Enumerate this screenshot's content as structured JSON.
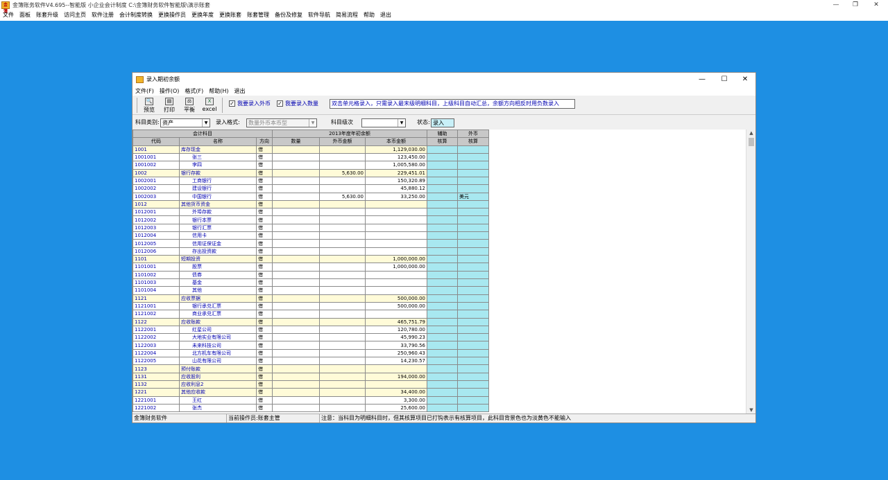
{
  "app": {
    "title": "金簿账务软件V4.695--智能版 小企业会计制度   C:\\金簿财务软件智能版\\演示账套",
    "icon_label": "金簿",
    "menu": [
      "文件",
      "面板",
      "账套升级",
      "访问主页",
      "软件注册",
      "会计制度转换",
      "更换操作员",
      "更换年度",
      "更换账套",
      "账套管理",
      "备份及修复",
      "软件导航",
      "简易流程",
      "帮助",
      "退出"
    ],
    "window_controls": {
      "minimize": "—",
      "restore": "❐",
      "close": "✕"
    }
  },
  "dialog": {
    "title": "录入期初余额",
    "menu": [
      "文件(F)",
      "操作(O)",
      "格式(F)",
      "帮助(H)",
      "退出"
    ],
    "window_controls": {
      "minimize": "—",
      "maximize": "☐",
      "close": "✕"
    },
    "toolbar": {
      "preview": "预览",
      "print": "打印",
      "balance": "平衡",
      "excel": "excel",
      "foreign_checkbox": "我要录入外币",
      "foreign_checked": "✓",
      "quantity_checkbox": "我要录入数量",
      "quantity_checked": "✓",
      "hint": "双击单元格录入，只需录入最末级明细科目，上级科目自动汇总，余额方向相反时用负数录入"
    },
    "filters": {
      "category_label": "科目类别:",
      "category_value": "资产",
      "format_label": "录入格式:",
      "format_value": "数量外币本币型",
      "level_label": "科目级次",
      "level_value": "",
      "status_label": "状态:",
      "status_value": "录入"
    },
    "grid": {
      "group_headers": {
        "account": "会计科目",
        "year": "2013年度年初余额",
        "aux": "辅助",
        "fx": "外币"
      },
      "headers": {
        "code": "代码",
        "name": "名称",
        "dir": "方向",
        "qty": "数量",
        "fx_amount": "外币金额",
        "amount": "本币金额",
        "aux_check": "核算",
        "fx_check": "核算"
      },
      "rows": [
        {
          "code": "1001",
          "name": "库存现金",
          "dir": "借",
          "qty": "",
          "fx": "",
          "amt": "1,129,030.00",
          "aux": "",
          "cur": "",
          "level": 1
        },
        {
          "code": "1001001",
          "name": "张三",
          "dir": "借",
          "qty": "",
          "fx": "",
          "amt": "123,450.00",
          "aux": "",
          "cur": "",
          "level": 2
        },
        {
          "code": "1001002",
          "name": "李四",
          "dir": "借",
          "qty": "",
          "fx": "",
          "amt": "1,005,580.00",
          "aux": "",
          "cur": "",
          "level": 2
        },
        {
          "code": "1002",
          "name": "银行存款",
          "dir": "借",
          "qty": "",
          "fx": "5,630.00",
          "amt": "229,451.01",
          "aux": "",
          "cur": "",
          "level": 1
        },
        {
          "code": "1002001",
          "name": "工商银行",
          "dir": "借",
          "qty": "",
          "fx": "",
          "amt": "150,320.89",
          "aux": "",
          "cur": "",
          "level": 2
        },
        {
          "code": "1002002",
          "name": "建设银行",
          "dir": "借",
          "qty": "",
          "fx": "",
          "amt": "45,880.12",
          "aux": "",
          "cur": "",
          "level": 2
        },
        {
          "code": "1002003",
          "name": "中国银行",
          "dir": "借",
          "qty": "",
          "fx": "5,630.00",
          "amt": "33,250.00",
          "aux": "",
          "cur": "美元",
          "level": 2
        },
        {
          "code": "1012",
          "name": "其他货币资金",
          "dir": "借",
          "qty": "",
          "fx": "",
          "amt": "",
          "aux": "",
          "cur": "",
          "level": 1
        },
        {
          "code": "1012001",
          "name": "外埠存款",
          "dir": "借",
          "qty": "",
          "fx": "",
          "amt": "",
          "aux": "",
          "cur": "",
          "level": 2
        },
        {
          "code": "1012002",
          "name": "银行本票",
          "dir": "借",
          "qty": "",
          "fx": "",
          "amt": "",
          "aux": "",
          "cur": "",
          "level": 2
        },
        {
          "code": "1012003",
          "name": "银行汇票",
          "dir": "借",
          "qty": "",
          "fx": "",
          "amt": "",
          "aux": "",
          "cur": "",
          "level": 2
        },
        {
          "code": "1012004",
          "name": "信用卡",
          "dir": "借",
          "qty": "",
          "fx": "",
          "amt": "",
          "aux": "",
          "cur": "",
          "level": 2
        },
        {
          "code": "1012005",
          "name": "信用证保证金",
          "dir": "借",
          "qty": "",
          "fx": "",
          "amt": "",
          "aux": "",
          "cur": "",
          "level": 2
        },
        {
          "code": "1012006",
          "name": "存出投资款",
          "dir": "借",
          "qty": "",
          "fx": "",
          "amt": "",
          "aux": "",
          "cur": "",
          "level": 2
        },
        {
          "code": "1101",
          "name": "短期投资",
          "dir": "借",
          "qty": "",
          "fx": "",
          "amt": "1,000,000.00",
          "aux": "",
          "cur": "",
          "level": 1
        },
        {
          "code": "1101001",
          "name": "股票",
          "dir": "借",
          "qty": "",
          "fx": "",
          "amt": "1,000,000.00",
          "aux": "",
          "cur": "",
          "level": 2
        },
        {
          "code": "1101002",
          "name": "债券",
          "dir": "借",
          "qty": "",
          "fx": "",
          "amt": "",
          "aux": "",
          "cur": "",
          "level": 2
        },
        {
          "code": "1101003",
          "name": "基金",
          "dir": "借",
          "qty": "",
          "fx": "",
          "amt": "",
          "aux": "",
          "cur": "",
          "level": 2
        },
        {
          "code": "1101004",
          "name": "其他",
          "dir": "借",
          "qty": "",
          "fx": "",
          "amt": "",
          "aux": "",
          "cur": "",
          "level": 2
        },
        {
          "code": "1121",
          "name": "应收票据",
          "dir": "借",
          "qty": "",
          "fx": "",
          "amt": "500,000.00",
          "aux": "",
          "cur": "",
          "level": 1
        },
        {
          "code": "1121001",
          "name": "银行承兑汇票",
          "dir": "借",
          "qty": "",
          "fx": "",
          "amt": "500,000.00",
          "aux": "",
          "cur": "",
          "level": 2
        },
        {
          "code": "1121002",
          "name": "商业承兑汇票",
          "dir": "借",
          "qty": "",
          "fx": "",
          "amt": "",
          "aux": "",
          "cur": "",
          "level": 2
        },
        {
          "code": "1122",
          "name": "应收账款",
          "dir": "借",
          "qty": "",
          "fx": "",
          "amt": "465,751.79",
          "aux": "",
          "cur": "",
          "level": 1
        },
        {
          "code": "1122001",
          "name": "红星公司",
          "dir": "借",
          "qty": "",
          "fx": "",
          "amt": "120,780.00",
          "aux": "",
          "cur": "",
          "level": 2
        },
        {
          "code": "1122002",
          "name": "大地实业有限公司",
          "dir": "借",
          "qty": "",
          "fx": "",
          "amt": "45,990.23",
          "aux": "",
          "cur": "",
          "level": 2
        },
        {
          "code": "1122003",
          "name": "未来科技公司",
          "dir": "借",
          "qty": "",
          "fx": "",
          "amt": "33,790.56",
          "aux": "",
          "cur": "",
          "level": 2
        },
        {
          "code": "1122004",
          "name": "北方机车有限公司",
          "dir": "借",
          "qty": "",
          "fx": "",
          "amt": "250,960.43",
          "aux": "",
          "cur": "",
          "level": 2
        },
        {
          "code": "1122005",
          "name": "山花有限公司",
          "dir": "借",
          "qty": "",
          "fx": "",
          "amt": "14,230.57",
          "aux": "",
          "cur": "",
          "level": 2
        },
        {
          "code": "1123",
          "name": "预付账款",
          "dir": "借",
          "qty": "",
          "fx": "",
          "amt": "",
          "aux": "",
          "cur": "",
          "level": 1
        },
        {
          "code": "1131",
          "name": "应收股利",
          "dir": "借",
          "qty": "",
          "fx": "",
          "amt": "194,000.00",
          "aux": "",
          "cur": "",
          "level": 1
        },
        {
          "code": "1132",
          "name": "应收利息2",
          "dir": "借",
          "qty": "",
          "fx": "",
          "amt": "",
          "aux": "",
          "cur": "",
          "level": 1
        },
        {
          "code": "1221",
          "name": "其他应收款",
          "dir": "借",
          "qty": "",
          "fx": "",
          "amt": "34,400.00",
          "aux": "",
          "cur": "",
          "level": 1
        },
        {
          "code": "1221001",
          "name": "王红",
          "dir": "借",
          "qty": "",
          "fx": "",
          "amt": "3,300.00",
          "aux": "",
          "cur": "",
          "level": 2
        },
        {
          "code": "1221002",
          "name": "张杰",
          "dir": "借",
          "qty": "",
          "fx": "",
          "amt": "25,600.00",
          "aux": "",
          "cur": "",
          "level": 2
        }
      ]
    },
    "status": {
      "software": "金簿财务软件",
      "operator": "当前操作员:账套主管",
      "note": "注意：当科目为明细科目时，但其核算项目已打钩表示有核算项目，此科目背景色也为淡黄色不能输入"
    }
  }
}
